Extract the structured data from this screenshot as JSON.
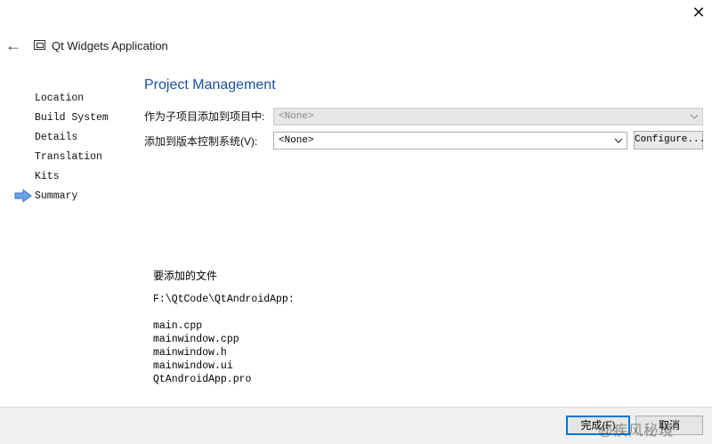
{
  "window": {
    "close_glyph": "✕"
  },
  "header": {
    "back_icon": "back-arrow-icon",
    "app_icon": "qt-window-icon",
    "title": "Qt Widgets Application"
  },
  "steps": [
    {
      "label": "Location",
      "current": false
    },
    {
      "label": "Build System",
      "current": false
    },
    {
      "label": "Details",
      "current": false
    },
    {
      "label": "Translation",
      "current": false
    },
    {
      "label": "Kits",
      "current": false
    },
    {
      "label": "Summary",
      "current": true
    }
  ],
  "page": {
    "heading": "Project Management",
    "add_subproject": {
      "label": "作为子项目添加到项目中:",
      "value": "<None>",
      "enabled": false
    },
    "version_control": {
      "label": "添加到版本控制系统(V):",
      "value": "<None>",
      "enabled": true
    },
    "configure_label": "Configure..."
  },
  "files": {
    "heading": "要添加的文件",
    "directory": "F:\\QtCode\\QtAndroidApp:",
    "list": [
      "main.cpp",
      "mainwindow.cpp",
      "mainwindow.h",
      "mainwindow.ui",
      "QtAndroidApp.pro"
    ]
  },
  "footer": {
    "finish_label": "完成(F)",
    "cancel_label": "取消",
    "watermark": "@疾风秘境"
  },
  "colors": {
    "heading": "#1c4f9c",
    "current_step_arrow": "#3a7bd5",
    "focus_border": "#0078d7"
  }
}
